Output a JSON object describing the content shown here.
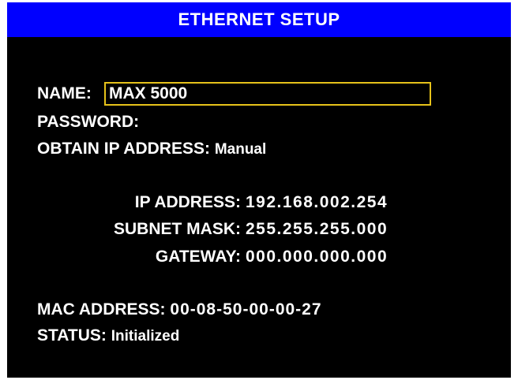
{
  "screen": {
    "title": "ETHERNET SETUP"
  },
  "form": {
    "name_label": "NAME:",
    "name_value": "MAX 5000",
    "password_label": "PASSWORD:",
    "password_value": "",
    "obtain_ip_label": "OBTAIN IP ADDRESS:",
    "obtain_ip_value": "Manual",
    "ip_address_label": "IP ADDRESS:",
    "ip_address_value": "192.168.002.254",
    "subnet_mask_label": "SUBNET MASK:",
    "subnet_mask_value": "255.255.255.000",
    "gateway_label": "GATEWAY:",
    "gateway_value": "000.000.000.000",
    "mac_address_label": "MAC ADDRESS:",
    "mac_address_value": "00-08-50-00-00-27",
    "status_label": "STATUS:",
    "status_value": "Initialized"
  },
  "colors": {
    "title_bar": "#0000ff",
    "background": "#000000",
    "text": "#ffffff",
    "focus_border": "#e6c21a"
  }
}
